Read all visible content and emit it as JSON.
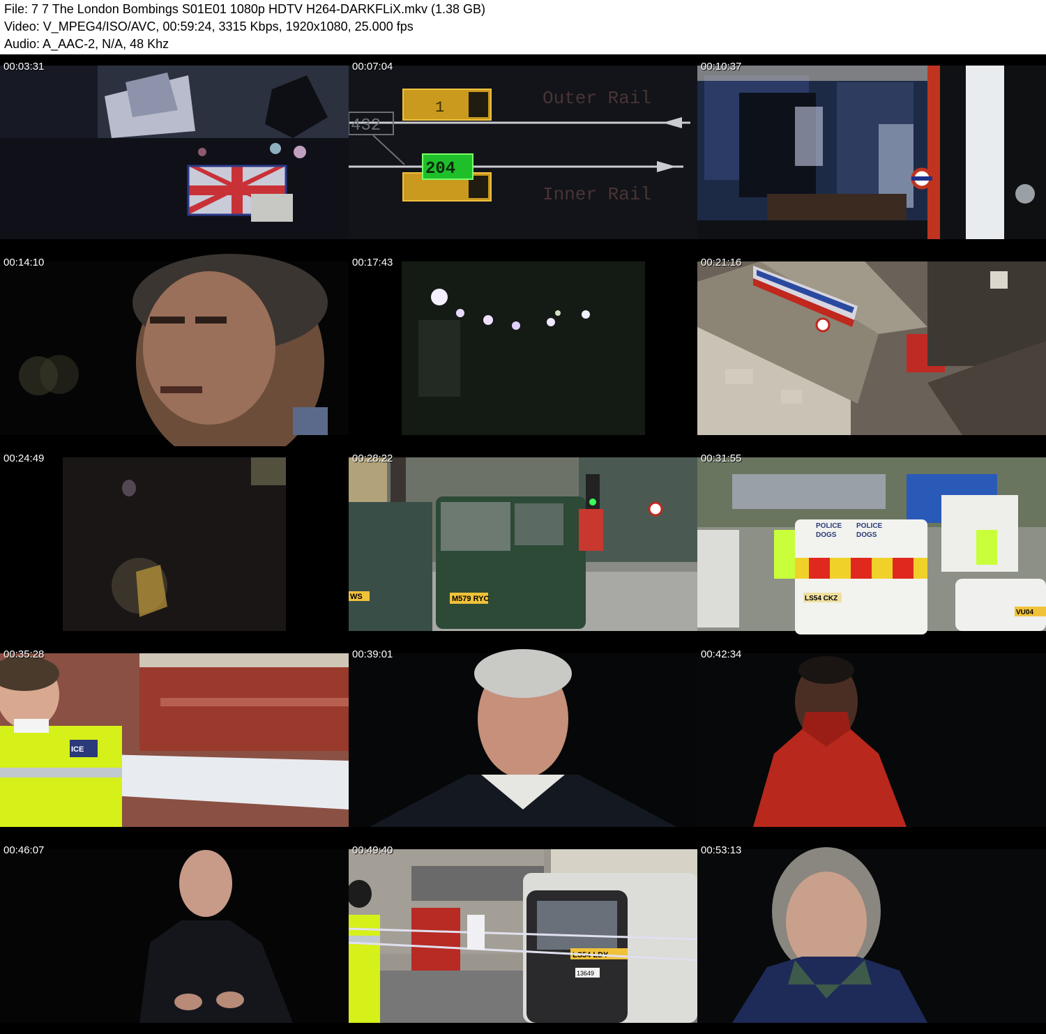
{
  "header": {
    "file_line": "File: 7 7 The London Bombings S01E01 1080p HDTV H264-DARKFLiX.mkv (1.38 GB)",
    "video_line": "Video: V_MPEG4/ISO/AVC, 00:59:24, 3315 Kbps, 1920x1080, 25.000 fps",
    "audio_line": "Audio: A_AAC-2, N/A, 48 Khz"
  },
  "thumbnails": [
    {
      "time": "00:03:31"
    },
    {
      "time": "00:07:04",
      "rail": {
        "id": "432",
        "top_block": "1",
        "bottom_code": "204",
        "outer": "Outer Rail",
        "inner": "Inner Rail"
      }
    },
    {
      "time": "00:10:37"
    },
    {
      "time": "00:14:10"
    },
    {
      "time": "00:17:43"
    },
    {
      "time": "00:21:16"
    },
    {
      "time": "00:24:49"
    },
    {
      "time": "00:28:22",
      "plate": "M579 RYC",
      "plate2": "WS"
    },
    {
      "time": "00:31:55",
      "sign1": "POLICE",
      "sign2": "DOGS",
      "sign3": "POLICE",
      "sign4": "DOGS",
      "plate": "LS54 CKZ",
      "plate2": "VU04"
    },
    {
      "time": "00:35:28",
      "tag": "ICE"
    },
    {
      "time": "00:39:01"
    },
    {
      "time": "00:42:34"
    },
    {
      "time": "00:46:07"
    },
    {
      "time": "00:49:40",
      "plate": "LS54 LDY",
      "plate2": "13649"
    },
    {
      "time": "00:53:13"
    }
  ]
}
